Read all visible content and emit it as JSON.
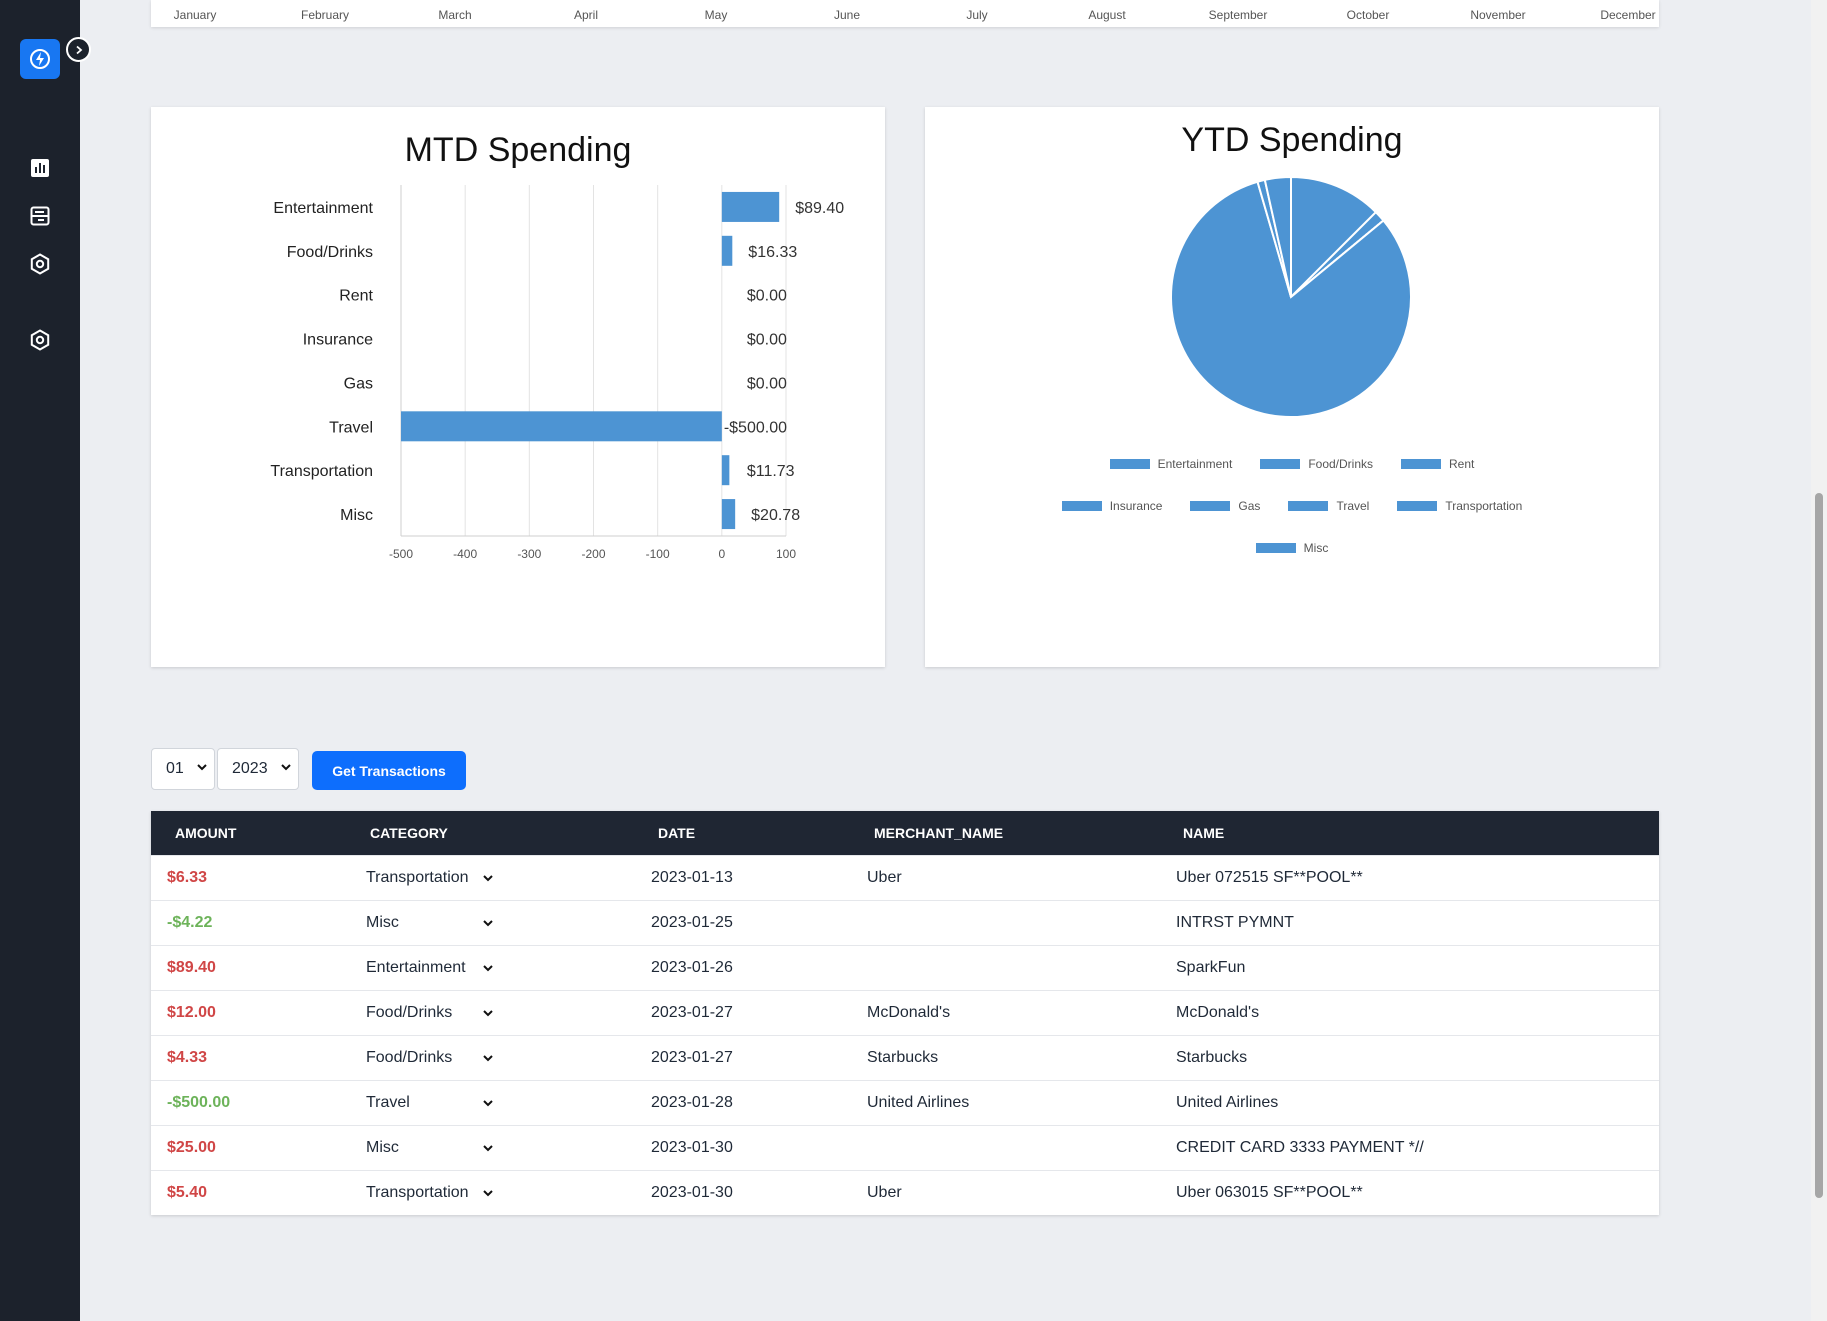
{
  "months": [
    "January",
    "February",
    "March",
    "April",
    "May",
    "June",
    "July",
    "August",
    "September",
    "October",
    "November",
    "December"
  ],
  "mtd": {
    "title": "MTD Spending",
    "chart_data": {
      "type": "bar",
      "orientation": "horizontal",
      "title": "MTD Spending",
      "categories": [
        "Entertainment",
        "Food/Drinks",
        "Rent",
        "Insurance",
        "Gas",
        "Travel",
        "Transportation",
        "Misc"
      ],
      "values": [
        89.4,
        16.33,
        0.0,
        0.0,
        0.0,
        -500.0,
        11.73,
        20.78
      ],
      "data_labels": [
        "$89.40",
        "$16.33",
        "$0.00",
        "$0.00",
        "$0.00",
        "-$500.00",
        "$11.73",
        "$20.78"
      ],
      "xlim": [
        -500,
        100
      ],
      "xticks": [
        "-500",
        "-400",
        "-300",
        "-200",
        "-100",
        "0",
        "100"
      ],
      "grid": true,
      "color": "#4d94d3"
    }
  },
  "ytd": {
    "title": "YTD Spending",
    "chart_data": {
      "type": "pie",
      "title": "YTD Spending",
      "categories": [
        "Entertainment",
        "Food/Drinks",
        "Rent",
        "Insurance",
        "Gas",
        "Travel",
        "Transportation",
        "Misc"
      ],
      "values": [
        12.5,
        1.5,
        0,
        0,
        0,
        81.5,
        1.0,
        3.5
      ],
      "color": "#4d94d3",
      "legend": "bottom"
    }
  },
  "controls": {
    "month_value": "01",
    "year_value": "2023",
    "get_button": "Get Transactions"
  },
  "table": {
    "headers": [
      "AMOUNT",
      "CATEGORY",
      "DATE",
      "MERCHANT_NAME",
      "NAME"
    ],
    "rows": [
      {
        "amount": "$6.33",
        "sign": "neg",
        "category": "Transportation",
        "date": "2023-01-13",
        "merchant": "Uber",
        "name": "Uber 072515 SF**POOL**"
      },
      {
        "amount": "-$4.22",
        "sign": "pos",
        "category": "Misc",
        "date": "2023-01-25",
        "merchant": "",
        "name": "INTRST PYMNT"
      },
      {
        "amount": "$89.40",
        "sign": "neg",
        "category": "Entertainment",
        "date": "2023-01-26",
        "merchant": "",
        "name": "SparkFun"
      },
      {
        "amount": "$12.00",
        "sign": "neg",
        "category": "Food/Drinks",
        "date": "2023-01-27",
        "merchant": "McDonald's",
        "name": "McDonald's"
      },
      {
        "amount": "$4.33",
        "sign": "neg",
        "category": "Food/Drinks",
        "date": "2023-01-27",
        "merchant": "Starbucks",
        "name": "Starbucks"
      },
      {
        "amount": "-$500.00",
        "sign": "pos",
        "category": "Travel",
        "date": "2023-01-28",
        "merchant": "United Airlines",
        "name": "United Airlines"
      },
      {
        "amount": "$25.00",
        "sign": "neg",
        "category": "Misc",
        "date": "2023-01-30",
        "merchant": "",
        "name": "CREDIT CARD 3333 PAYMENT *//"
      },
      {
        "amount": "$5.40",
        "sign": "neg",
        "category": "Transportation",
        "date": "2023-01-30",
        "merchant": "Uber",
        "name": "Uber 063015 SF**POOL**"
      }
    ]
  },
  "icons": {
    "logo": "lightning-icon",
    "collapse": "chevron-right-icon",
    "nav": [
      "bar-chart-icon",
      "transactions-icon",
      "settings-icon",
      "settings-icon"
    ]
  }
}
